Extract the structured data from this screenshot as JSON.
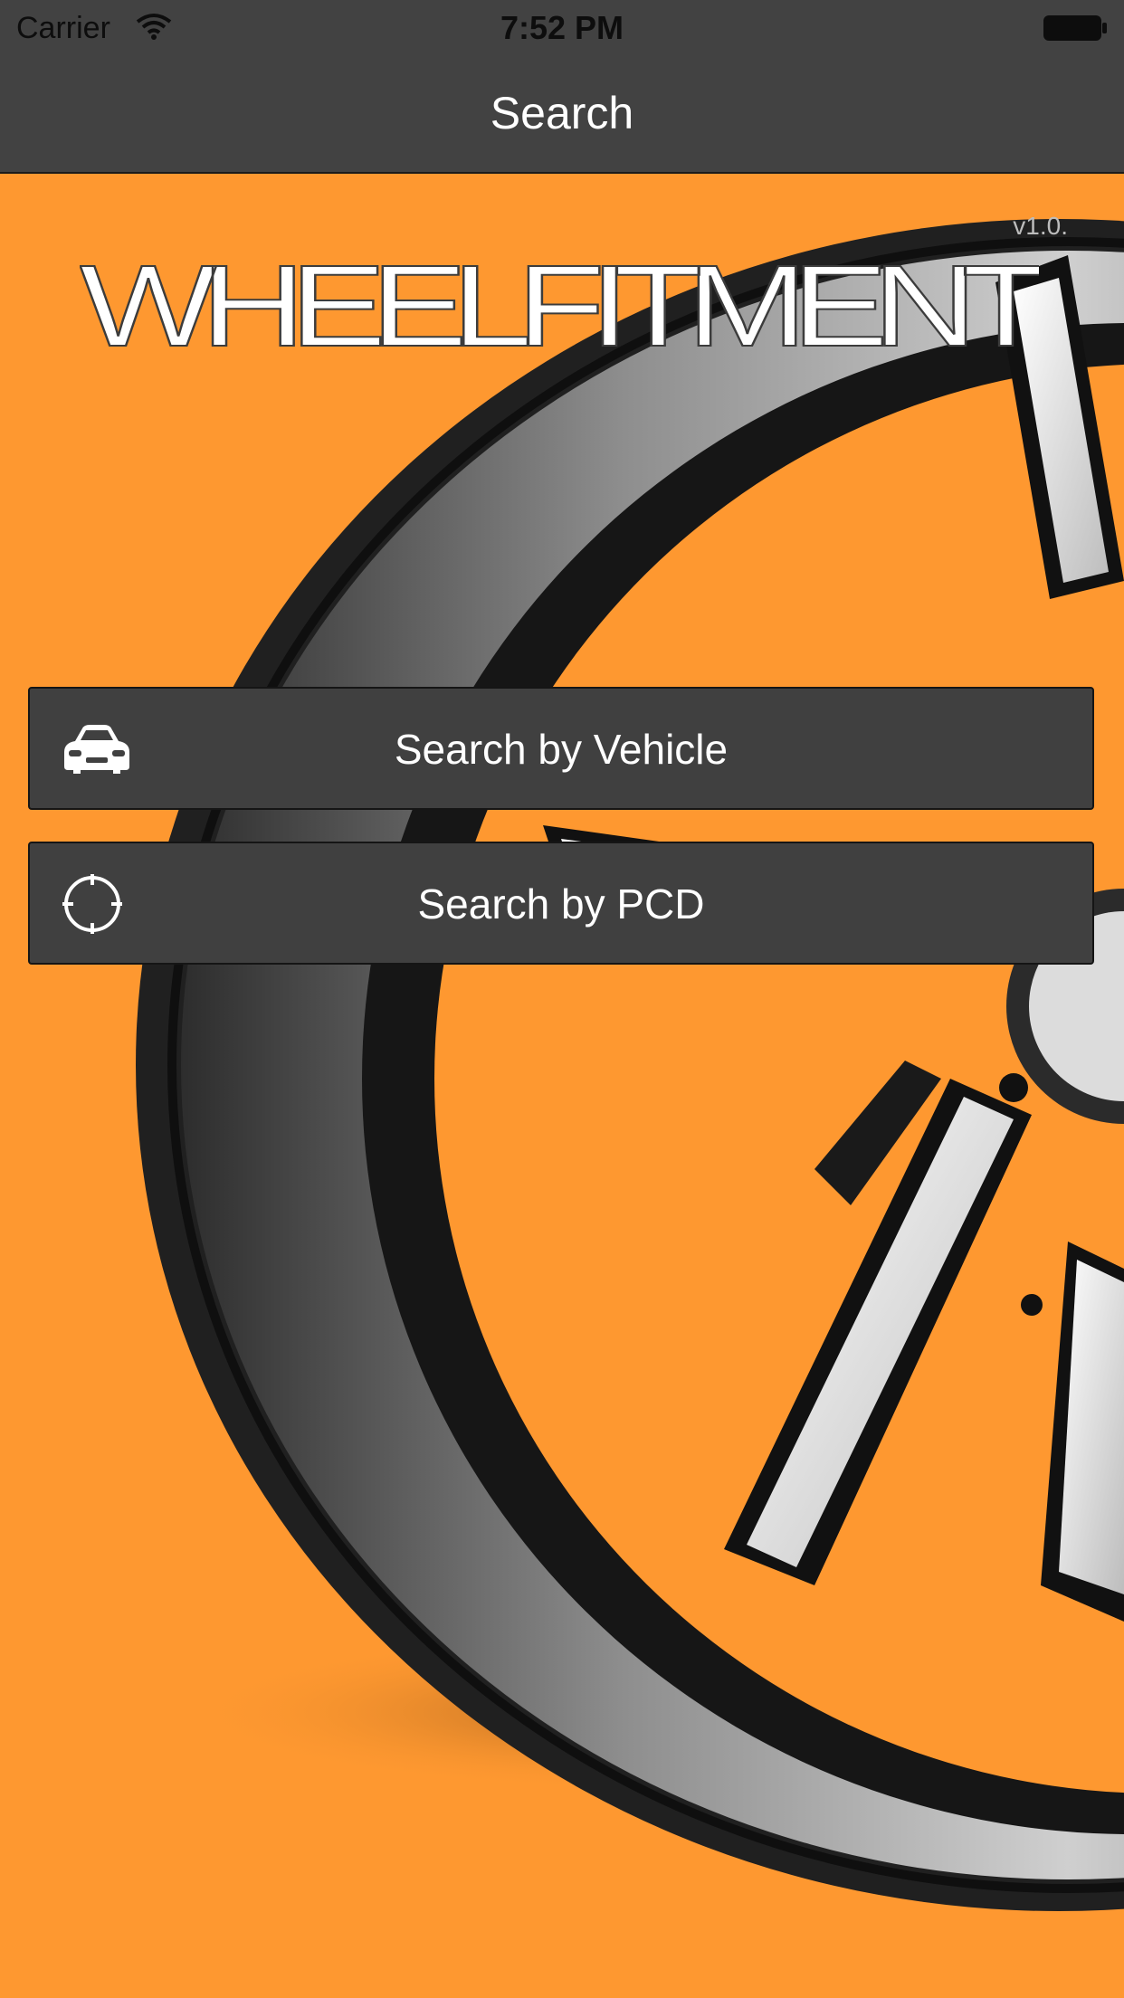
{
  "status_bar": {
    "carrier": "Carrier",
    "time": "7:52 PM",
    "icons": [
      "wifi-icon",
      "battery-icon"
    ]
  },
  "nav": {
    "title": "Search"
  },
  "header": {
    "version": "v1.0.",
    "logo_text": "WHEELFITMENT"
  },
  "buttons": {
    "vehicle": {
      "label": "Search by Vehicle",
      "icon": "car-icon"
    },
    "pcd": {
      "label": "Search by PCD",
      "icon": "crosshair-icon"
    }
  },
  "colors": {
    "background": "#fe9830",
    "bar": "#424242",
    "button": "#404040",
    "text": "#ffffff"
  }
}
